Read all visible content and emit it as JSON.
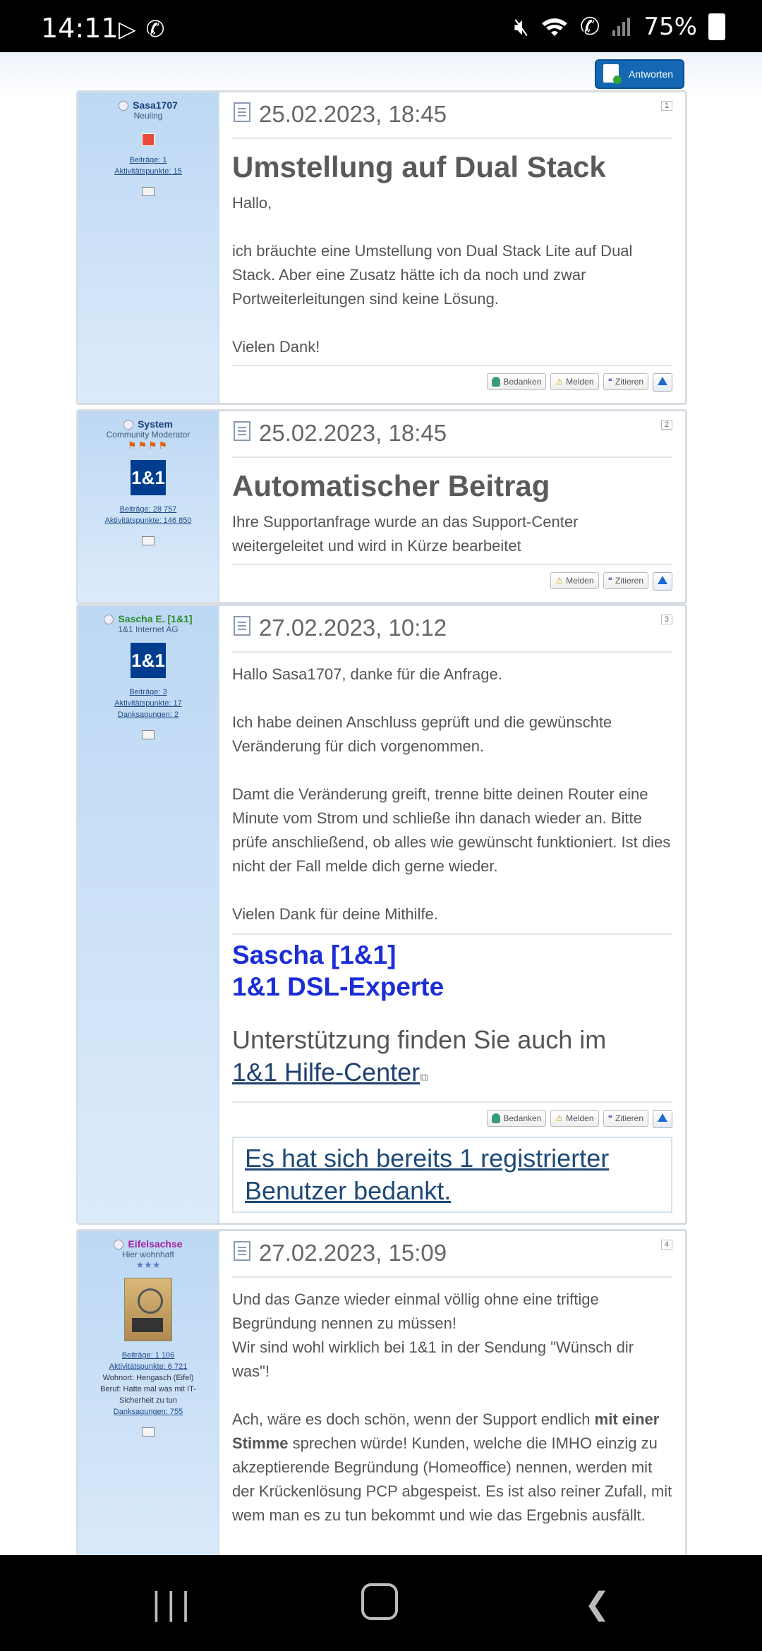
{
  "status_bar": {
    "time": "14:11",
    "battery": "75%"
  },
  "toolbar": {
    "reply_label": "Antworten"
  },
  "actions": {
    "thank": "Bedanken",
    "report": "Melden",
    "quote": "Zitieren"
  },
  "posts": [
    {
      "user": {
        "name": "Sasa1707",
        "rank": "Neuling",
        "posts": "Beiträge: 1",
        "activity": "Aktivitätspunkte: 15"
      },
      "date": "25.02.2023, 18:45",
      "number": "1",
      "title": "Umstellung auf Dual Stack",
      "text": {
        "p1": "Hallo,",
        "p2": "ich bräuchte eine Umstellung von Dual Stack Lite auf Dual Stack. Aber eine Zusatz hätte ich da noch und zwar Portweiterleitungen sind keine Lösung.",
        "p3": "Vielen Dank!"
      }
    },
    {
      "user": {
        "name": "System",
        "rank": "Community Moderator",
        "avatar_text": "1&1",
        "posts": "Beiträge: 28 757",
        "activity": "Aktivitätspunkte: 146 850"
      },
      "date": "25.02.2023, 18:45",
      "number": "2",
      "title": "Automatischer Beitrag",
      "text": {
        "p1": "Ihre Supportanfrage wurde an das Support-Center weitergeleitet und wird in Kürze bearbeitet"
      }
    },
    {
      "user": {
        "name": "Sascha E. [1&1]",
        "rank": "1&1 Internet AG",
        "avatar_text": "1&1",
        "posts": "Beiträge: 3",
        "activity": "Aktivitätspunkte: 17",
        "thanks": "Danksagungen: 2"
      },
      "date": "27.02.2023, 10:12",
      "number": "3",
      "text": {
        "p1": "Hallo Sasa1707, danke für die Anfrage.",
        "p2": "Ich habe deinen Anschluss geprüft und die gewünschte Veränderung für dich vorgenommen.",
        "p3": "Damt die Veränderung greift, trenne bitte deinen Router eine Minute vom Strom und schließe ihn danach wieder an. Bitte prüfe anschließend, ob alles wie gewünscht funktioniert. Ist dies nicht der Fall melde dich gerne wieder.",
        "p4": "Vielen Dank für deine Mithilfe."
      },
      "signature": {
        "line1": "Sascha [1&1]",
        "line2": "1&1 DSL-Experte",
        "help_prefix": "Unterstützung finden Sie auch im",
        "help_link": "1&1 Hilfe-Center"
      },
      "thanks_box": "Es hat sich bereits 1 registrierter Benutzer bedankt."
    },
    {
      "user": {
        "name": "Eifelsachse",
        "rank": "Hier wohnhaft",
        "posts": "Beiträge: 1 106",
        "activity": "Aktivitätspunkte: 6 721",
        "location": "Wohnort: Hengasch (Eifel)",
        "job": "Beruf: Hatte mal was mit IT-Sicherheit zu tun",
        "thanks": "Danksagungen: 755"
      },
      "date": "27.02.2023, 15:09",
      "number": "4",
      "text": {
        "p1": "Und das Ganze wieder einmal völlig ohne eine triftige Begründung nennen zu müssen!",
        "p2": "Wir sind wohl wirklich bei 1&1 in der Sendung \"Wünsch dir was\"!",
        "p3a": "Ach, wäre es doch schön, wenn der Support endlich ",
        "p3b": "mit einer Stimme",
        "p3c": " sprechen würde! Kunden, welche die IMHO einzig zu akzeptierende Begründung (Homeoffice) nennen, werden mit der Krückenlösung PCP abgespeist. Es ist also reiner Zufall, mit wem man es zu tun bekommt und wie das Ergebnis ausfällt."
      }
    }
  ]
}
